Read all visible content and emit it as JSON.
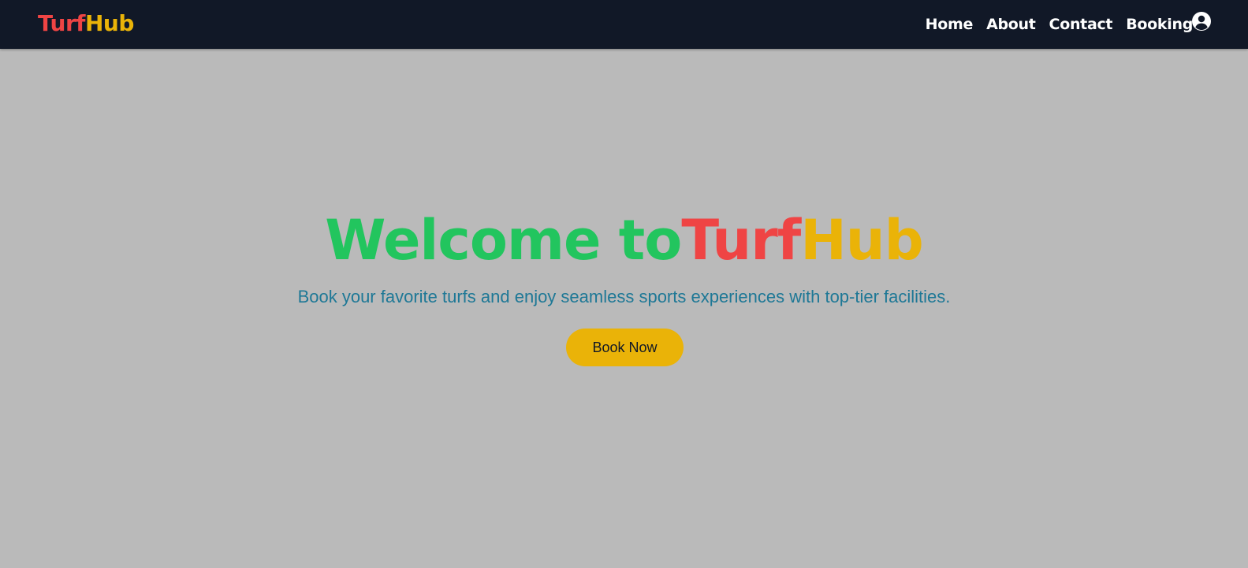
{
  "brand": {
    "part1": "Turf",
    "part2": "Hub"
  },
  "nav": {
    "items": [
      {
        "label": "Home"
      },
      {
        "label": "About"
      },
      {
        "label": "Contact"
      },
      {
        "label": "Booking"
      }
    ],
    "profile_icon": "user-circle-icon"
  },
  "hero": {
    "title_prefix": "Welcome to",
    "title_turf": "Turf",
    "title_hub": "Hub",
    "subtitle": "Book your favorite turfs and enjoy seamless sports experiences with top-tier facilities.",
    "cta_label": "Book Now"
  },
  "colors": {
    "navbar_bg": "#111827",
    "page_bg": "#bababa",
    "brand_red": "#ef4444",
    "brand_yellow": "#eab308",
    "welcome_green": "#22c55e",
    "subtitle_teal": "#1e7896"
  }
}
